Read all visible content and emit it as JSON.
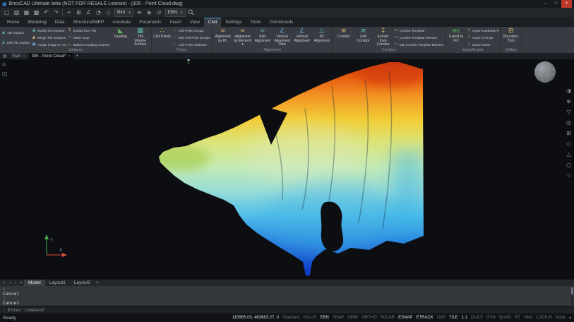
{
  "titlebar": {
    "app_glyph": "▣",
    "title": "BricsCAD Ultimate beta (NOT FOR RESALE License) - [305 - Point Cloud.dwg]",
    "minimize": "–",
    "maximize": "□",
    "close": "×"
  },
  "qat": {
    "icons": [
      {
        "name": "new-icon",
        "glyph": "▢"
      },
      {
        "name": "open-icon",
        "glyph": "▧"
      },
      {
        "name": "save-icon",
        "glyph": "▦"
      },
      {
        "name": "print-icon",
        "glyph": "▩"
      },
      {
        "name": "undo-icon",
        "glyph": "↶"
      },
      {
        "name": "redo-icon",
        "glyph": "↷"
      },
      {
        "name": "crosshair-icon",
        "glyph": "⌖"
      },
      {
        "name": "snap-grid-icon",
        "glyph": "⊞"
      },
      {
        "name": "angle-icon",
        "glyph": "∠"
      },
      {
        "name": "arc-icon",
        "glyph": "◔"
      },
      {
        "name": "polygon-icon",
        "glyph": "◇"
      },
      {
        "name": "layers-icon",
        "glyph": "≡"
      },
      {
        "name": "materials-icon",
        "glyph": "◈"
      },
      {
        "name": "render-icon",
        "glyph": "⊙"
      }
    ],
    "workspace": {
      "value": "Bim",
      "caret": "▾"
    },
    "profile": {
      "value": "EBN",
      "caret": "▾"
    }
  },
  "ribbon": {
    "tabs": [
      {
        "label": "Home"
      },
      {
        "label": "Modeling"
      },
      {
        "label": "Data"
      },
      {
        "label": "Structural/MEP"
      },
      {
        "label": "Annotate"
      },
      {
        "label": "Parametric"
      },
      {
        "label": "Insert"
      },
      {
        "label": "View"
      },
      {
        "label": "Civil"
      },
      {
        "label": "Settings"
      },
      {
        "label": "Tools"
      },
      {
        "label": "Pointclouds"
      }
    ],
    "surfaces": {
      "label": "Surfaces",
      "stack": [
        {
          "glyph": "▲",
          "label": "TIN Surface"
        },
        {
          "glyph": "◭",
          "label": "Edit TIN Surface"
        }
      ],
      "col1": [
        {
          "glyph": "▲",
          "label": "Modify TIN Surface"
        },
        {
          "glyph": "▲",
          "label": "Merge TIN Surfaces"
        },
        {
          "glyph": "▣",
          "label": "Assign Image to TIN"
        }
      ],
      "col2": [
        {
          "glyph": "↧",
          "label": "Extract from TIN"
        },
        {
          "glyph": "≈",
          "label": "Water Drop"
        },
        {
          "glyph": "◺",
          "label": "Balance Grading Volumes"
        }
      ],
      "big": [
        {
          "glyph": "◣",
          "label": "Grading"
        },
        {
          "glyph": "▦",
          "label": "TIN Volume Surface"
        }
      ]
    },
    "points": {
      "label": "Points",
      "big": {
        "glyph": "∴",
        "label": "Civil Points"
      },
      "col": [
        {
          "glyph": "∴",
          "label": "Civil Point Groups"
        },
        {
          "glyph": "∴",
          "label": "Edit Civil Point Groups"
        },
        {
          "glyph": "∴",
          "label": "Civil Point Attributes"
        }
      ]
    },
    "alignments": {
      "label": "Alignments",
      "big": [
        {
          "glyph": "≈",
          "label": "Alignment by PL"
        },
        {
          "glyph": "≈",
          "label": "Alignment by Element ▾"
        },
        {
          "glyph": "≈",
          "label": "Edit Alignment"
        },
        {
          "glyph": "∠",
          "label": "Vertical Alignment View"
        },
        {
          "glyph": "∠",
          "label": "Vertical Alignment"
        },
        {
          "glyph": "△",
          "label": "3D Alignment"
        }
      ]
    },
    "corridors": {
      "label": "Corridors",
      "big": [
        {
          "glyph": "≡",
          "label": "Corridor"
        },
        {
          "glyph": "≡",
          "label": "Edit Corridor"
        },
        {
          "glyph": "↧",
          "label": "Extract from Corridor"
        }
      ],
      "col": [
        {
          "glyph": "▭",
          "label": "Corridor Template"
        },
        {
          "glyph": "▭",
          "label": "Corridor Template Element"
        },
        {
          "glyph": "▭",
          "label": "Edit Corridor Template Element"
        }
      ]
    },
    "importexport": {
      "label": "Import/Export",
      "big": {
        "glyph": "IFC",
        "label": "Export to IFC"
      },
      "col": [
        {
          "glyph": "↥",
          "label": "Import LandXML ▾"
        },
        {
          "glyph": "↥",
          "label": "Import Civil 3D"
        },
        {
          "glyph": "↧",
          "label": "Export DWG"
        }
      ]
    },
    "utilities": {
      "label": "Utilities",
      "big": {
        "glyph": "⊟",
        "label": "Boundary Trim"
      }
    }
  },
  "doc_tabs": {
    "menu_glyph": "▤",
    "tabs": [
      {
        "label": "Start",
        "close": "×"
      },
      {
        "label": "305 - Point Cloud*",
        "close": "×"
      }
    ],
    "add": "+"
  },
  "canvas": {
    "left_icons": [
      {
        "name": "home-icon",
        "glyph": "⌂"
      },
      {
        "name": "sheet-icon",
        "glyph": "◱"
      }
    ],
    "right_toolbar": [
      {
        "name": "visual-styles-icon",
        "glyph": "◑"
      },
      {
        "name": "sun-icon",
        "glyph": "⊕"
      },
      {
        "name": "filter-icon",
        "glyph": "▽"
      },
      {
        "name": "section-icon",
        "glyph": "◎"
      },
      {
        "name": "grid-icon",
        "glyph": "⊞"
      },
      {
        "name": "materials-icon",
        "glyph": "◇"
      },
      {
        "name": "orbit-icon",
        "glyph": "△"
      },
      {
        "name": "sphere-icon",
        "glyph": "○"
      },
      {
        "name": "favorites-icon",
        "glyph": "☆"
      }
    ],
    "ucs": {
      "x_label": "X",
      "y_label": "Y"
    },
    "background": "#0c0e11",
    "heatmap_palette": [
      "#c2340e",
      "#f29424",
      "#f2cc34",
      "#dce478",
      "#c4eab4",
      "#52c0ea",
      "#2a86e0",
      "#0f3ec8"
    ]
  },
  "layout_bar": {
    "nav": [
      "«",
      "‹",
      "›",
      "»"
    ],
    "tabs": [
      {
        "label": "Model"
      },
      {
        "label": "Layout1"
      },
      {
        "label": "Layout2"
      }
    ],
    "add": "+"
  },
  "command": {
    "lines": [
      ":",
      "Cancel",
      ":",
      "Cancel"
    ],
    "prompt_symbol": ":",
    "prompt": "Enter command"
  },
  "statusbar": {
    "ready": "Ready",
    "coords": "115965.03, 463663.27, 0",
    "items": [
      {
        "label": "Standard"
      },
      {
        "label": "ISO-25"
      },
      {
        "label": "EBN"
      },
      {
        "label": "SNAP"
      },
      {
        "label": "GRID"
      },
      {
        "label": "ORTHO"
      },
      {
        "label": "POLAR"
      },
      {
        "label": "ESNAP"
      },
      {
        "label": "ETRACK"
      },
      {
        "label": "LWT"
      },
      {
        "label": "TILE"
      },
      {
        "label": "1:1"
      },
      {
        "label": "DUCS"
      },
      {
        "label": "DYN"
      },
      {
        "label": "QUAD"
      },
      {
        "label": "RT"
      },
      {
        "label": "HKA"
      },
      {
        "label": "LOCKUI"
      },
      {
        "label": "None"
      }
    ],
    "caret": "▾"
  }
}
